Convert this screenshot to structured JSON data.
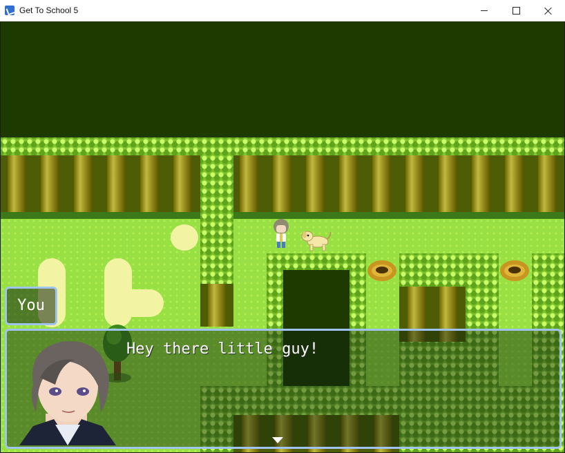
{
  "window": {
    "title": "Get To School 5",
    "icon": "app-icon",
    "controls": [
      "minimize-icon",
      "maximize-icon",
      "close-icon"
    ]
  },
  "dialog": {
    "speaker": "You",
    "message": "Hey there little guy!",
    "continue_indicator": "pause-arrow-icon"
  },
  "scene": {
    "colors": {
      "grass": "#98e043",
      "hedge": "#7fc22c",
      "darkness": "#1e3a00",
      "window_border": "#9fc4f0"
    },
    "characters": [
      "player",
      "dog"
    ]
  }
}
